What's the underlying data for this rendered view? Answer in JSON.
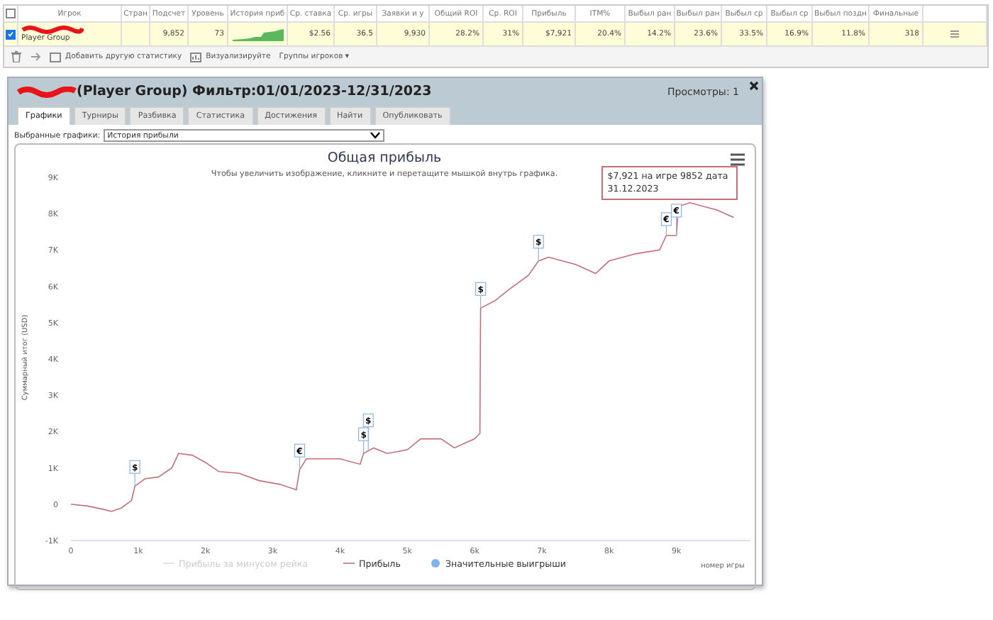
{
  "stats_table": {
    "columns": [
      "Игрок",
      "Стран",
      "Подсчет",
      "Уровень",
      "История приб",
      "Ср. ставка",
      "Ср. игры",
      "Заявки и у",
      "Общий ROI",
      "Ср. ROI",
      "Прибыль",
      "ITM%",
      "Выбыл ран",
      "Выбыл ран",
      "Выбыл ср",
      "Выбыл ср",
      "Выбыл поздн",
      "Финальные"
    ],
    "select_all_checked": false,
    "rows": [
      {
        "checked": true,
        "cells": [
          "Player Group",
          "",
          "9,852",
          "73",
          "",
          "$2.56",
          "36.5",
          "9,930",
          "28.2%",
          "31%",
          "$7,921",
          "20.4%",
          "14.2%",
          "23.6%",
          "33.5%",
          "16.9%",
          "11.8%",
          "318"
        ]
      }
    ],
    "toolbar": [
      "Добавить другую статистику",
      "Визуализируйте",
      "Группы игроков ▾"
    ]
  },
  "panel": {
    "title": "(Player Group) Фильтр:01/01/2023-12/31/2023",
    "views": "Просмотры: 1",
    "tabs": [
      {
        "label": "Графики",
        "selected": true
      },
      {
        "label": "Турниры",
        "selected": false
      },
      {
        "label": "Разбивка",
        "selected": false
      },
      {
        "label": "Статистика",
        "selected": false
      },
      {
        "label": "Достижения",
        "selected": false
      },
      {
        "label": "Найти",
        "selected": false
      },
      {
        "label": "Опубликовать",
        "selected": false
      }
    ],
    "chart_select_label": "Выбранные графики:",
    "chart_select_value": "История прибыли",
    "chart": {
      "tooltip": "$7,921 на игре 9852 дата 31.12.2023",
      "legend": [
        {
          "label": "Прибыль за минусом рейка",
          "kind": "line",
          "visible": false
        },
        {
          "label": "Значительные выигрыши",
          "kind": "marker",
          "visible": true
        }
      ],
      "chart_data": {
        "type": "line",
        "title": "Общая прибыль",
        "subtitle": "Чтобы увеличить изображение, кликните и перетащите мышкой внутрь графика.",
        "xlabel": "номер игры",
        "ylabel": "Суммарный итог (USD)",
        "x": [
          0,
          250,
          500,
          600,
          750,
          900,
          950,
          1100,
          1300,
          1500,
          1600,
          1800,
          2000,
          2200,
          2500,
          2800,
          3100,
          3350,
          3400,
          3500,
          3800,
          4000,
          4300,
          4350,
          4500,
          4700,
          5000,
          5200,
          5500,
          5700,
          6000,
          6080,
          6090,
          6300,
          6500,
          6800,
          6950,
          7100,
          7500,
          7800,
          8000,
          8400,
          8750,
          8850,
          9000,
          9030,
          9200,
          9600,
          9852
        ],
        "series": [
          {
            "name": "Прибыль",
            "color": "#c46f78",
            "values": [
              0,
              -50,
              -150,
              -200,
              -100,
              100,
              500,
              700,
              750,
              1000,
              1400,
              1350,
              1150,
              900,
              850,
              650,
              550,
              400,
              950,
              1250,
              1250,
              1250,
              1100,
              1400,
              1550,
              1400,
              1500,
              1800,
              1800,
              1550,
              1800,
              1950,
              5400,
              5600,
              5900,
              6300,
              6700,
              6800,
              6600,
              6350,
              6700,
              6900,
              7000,
              7400,
              7400,
              8200,
              8300,
              8100,
              7900
            ]
          }
        ],
        "xlim": [
          0,
          10100
        ],
        "ylim": [
          -1000,
          9000
        ],
        "xticks": [
          {
            "value": 0,
            "label": "0"
          },
          {
            "value": 1000,
            "label": "1k"
          },
          {
            "value": 2000,
            "label": "2k"
          },
          {
            "value": 3000,
            "label": "3k"
          },
          {
            "value": 4000,
            "label": "4k"
          },
          {
            "value": 5000,
            "label": "5k"
          },
          {
            "value": 6000,
            "label": "6k"
          },
          {
            "value": 7000,
            "label": "7k"
          },
          {
            "value": 8000,
            "label": "8k"
          },
          {
            "value": 9000,
            "label": "9k"
          }
        ],
        "yticks": [
          {
            "value": -1000,
            "label": "-1K"
          },
          {
            "value": 0,
            "label": "0"
          },
          {
            "value": 1000,
            "label": "1K"
          },
          {
            "value": 2000,
            "label": "2K"
          },
          {
            "value": 3000,
            "label": "3K"
          },
          {
            "value": 4000,
            "label": "4K"
          },
          {
            "value": 5000,
            "label": "5K"
          },
          {
            "value": 6000,
            "label": "6K"
          },
          {
            "value": 7000,
            "label": "7K"
          },
          {
            "value": 8000,
            "label": "8K"
          },
          {
            "value": 9000,
            "label": "9K"
          }
        ],
        "annotations": [
          "$",
          "€",
          "$",
          "$",
          "$",
          "$",
          "€",
          "€"
        ]
      }
    }
  }
}
